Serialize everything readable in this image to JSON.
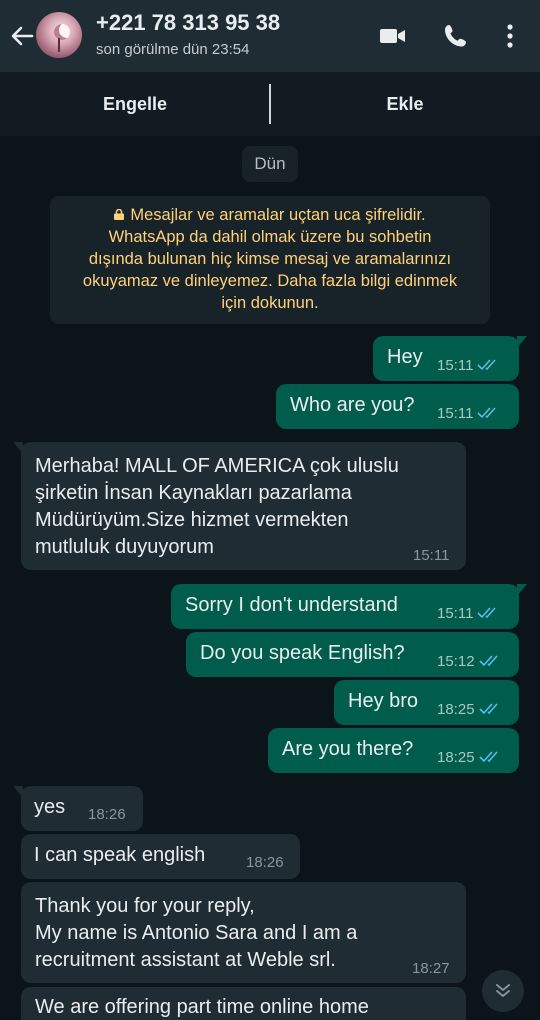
{
  "header": {
    "contact_name": "+221 78 313 95 38",
    "status": "son görülme dün 23:54",
    "icons": [
      "back-arrow-icon",
      "video-call-icon",
      "phone-icon",
      "more-options-icon"
    ]
  },
  "actions": {
    "block_label": "Engelle",
    "add_label": "Ekle"
  },
  "date_chip": "Dün",
  "encryption_notice": {
    "line1": "Mesajlar ve aramalar uçtan uca şifrelidir.",
    "line2": "WhatsApp da dahil olmak üzere bu sohbetin",
    "line3": "dışında bulunan hiç kimse mesaj ve aramalarınızı",
    "line4": "okuyamaz ve dinleyemez. Daha fazla bilgi edinmek",
    "line5": "için dokunun."
  },
  "messages": [
    {
      "dir": "out",
      "text": "Hey",
      "time": "15:11",
      "read": true
    },
    {
      "dir": "out",
      "text": "Who are you?",
      "time": "15:11",
      "read": true
    },
    {
      "dir": "in",
      "lines": [
        "Merhaba!  MALL OF AMERICA çok uluslu",
        "şirketin İnsan Kaynakları pazarlama",
        "Müdürüyüm.Size hizmet vermekten",
        "mutluluk duyuyorum"
      ],
      "time": "15:11"
    },
    {
      "dir": "out",
      "text": "Sorry I don't understand",
      "time": "15:11",
      "read": true
    },
    {
      "dir": "out",
      "text": "Do you speak English?",
      "time": "15:12",
      "read": true
    },
    {
      "dir": "out",
      "text": "Hey bro",
      "time": "18:25",
      "read": true
    },
    {
      "dir": "out",
      "text": "Are you there?",
      "time": "18:25",
      "read": true
    },
    {
      "dir": "in",
      "text": "yes",
      "time": "18:26"
    },
    {
      "dir": "in",
      "text": "I can speak english",
      "time": "18:26"
    },
    {
      "dir": "in",
      "lines": [
        "Thank you for your reply,",
        "My name is Antonio Sara and I am a",
        "recruitment assistant at Weble srl."
      ],
      "time": "18:27"
    },
    {
      "dir": "in",
      "text": "We are offering part time online home",
      "time": ""
    }
  ],
  "colors": {
    "header_bg": "#1f2c34",
    "chat_bg": "#0b141a",
    "outgoing_bubble": "#005c4b",
    "incoming_bubble": "#202c33",
    "read_tick": "#53bdeb",
    "notice_text": "#ffd279"
  }
}
